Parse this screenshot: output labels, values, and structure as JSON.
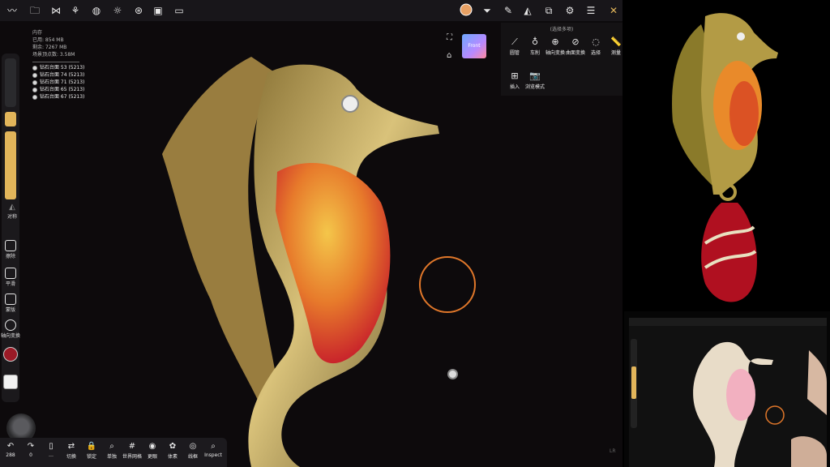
{
  "topbar": {
    "icons_left": [
      "logo-icon",
      "folder-icon",
      "share-icon",
      "layers-icon",
      "globe-icon",
      "sun-icon",
      "material-icon",
      "image-icon",
      "video-icon"
    ],
    "icons_right": [
      "material-ball-icon",
      "filter-icon",
      "brush-icon",
      "triangle-icon",
      "stack-icon",
      "gear-icon",
      "sliders-icon",
      "tools-icon"
    ]
  },
  "memory": {
    "title": "内存",
    "used": "已用: 854 MB",
    "free": "剩余: 7267 MB",
    "vertices": "场景顶点数: 3.58M"
  },
  "objects": [
    "钻石台面 53 (5213)",
    "钻石台面 74 (5213)",
    "钻石台面 71 (5213)",
    "钻石台面 65 (5213)",
    "钻石台面 67 (5213)"
  ],
  "left_tools": {
    "symmetry": "对称",
    "erase": "擦除",
    "smooth": "平滑",
    "mask": "蒙版",
    "axial": "轴向变换"
  },
  "bottom_toolbar": [
    {
      "glyph": "↶",
      "label": "288",
      "name": "undo-button"
    },
    {
      "glyph": "↷",
      "label": "0",
      "name": "redo-button"
    },
    {
      "glyph": "▯",
      "label": "…",
      "name": "more-button"
    },
    {
      "glyph": "⇄",
      "label": "切换",
      "name": "switch-button"
    },
    {
      "glyph": "🔒",
      "label": "锁定",
      "name": "lock-button"
    },
    {
      "glyph": "⌕",
      "label": "单独",
      "name": "solo-button"
    },
    {
      "glyph": "#",
      "label": "世界网格",
      "name": "world-grid-button"
    },
    {
      "glyph": "◉",
      "label": "更眼",
      "name": "view-button"
    },
    {
      "glyph": "✿",
      "label": "体素",
      "name": "voxel-button"
    },
    {
      "glyph": "◎",
      "label": "线框",
      "name": "wireframe-button"
    },
    {
      "glyph": "⌕",
      "label": "Inspect",
      "name": "inspect-button"
    }
  ],
  "gizmo": {
    "label": "Front"
  },
  "tool_panel": {
    "header": "(选择多项)",
    "items_row1": [
      {
        "glyph": "⟋",
        "label": "圆管",
        "name": "tube-tool"
      },
      {
        "glyph": "♁",
        "label": "车削",
        "name": "lathe-tool"
      },
      {
        "glyph": "⊕",
        "label": "轴向变换",
        "name": "axial-transform-tool"
      },
      {
        "glyph": "⊘",
        "label": "曲面变换",
        "name": "surface-transform-tool"
      },
      {
        "glyph": "◌",
        "label": "选择",
        "name": "select-tool"
      },
      {
        "glyph": "📏",
        "label": "测量",
        "name": "measure-tool"
      }
    ],
    "items_row2": [
      {
        "glyph": "⊞",
        "label": "插入",
        "name": "insert-tool"
      },
      {
        "glyph": "📷",
        "label": "浏览模式",
        "name": "browse-mode-tool"
      }
    ]
  },
  "corner_label": "LR",
  "colors": {
    "accent": "#e2b55a",
    "brush": "#e0772a",
    "gold": "#c9a74f",
    "topbar": "#18161a"
  }
}
